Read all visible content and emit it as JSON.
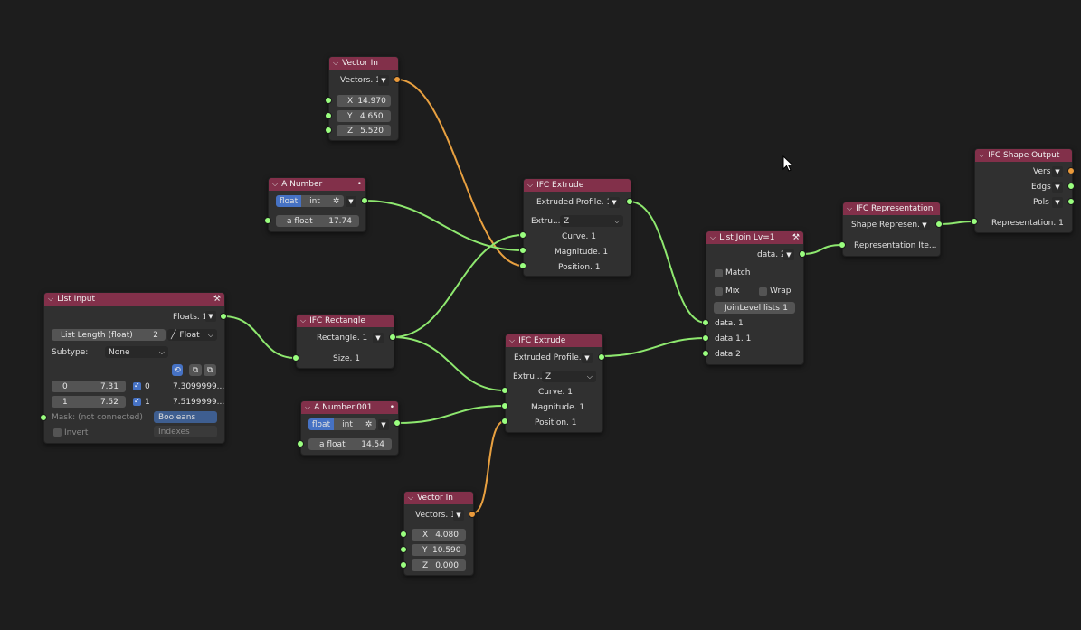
{
  "nodes": {
    "vector_in_1": {
      "title": "Vector In",
      "out_label": "Vectors. 1",
      "fields": [
        {
          "axis": "X",
          "value": "14.970"
        },
        {
          "axis": "Y",
          "value": "4.650"
        },
        {
          "axis": "Z",
          "value": "5.520"
        }
      ]
    },
    "a_number": {
      "title": "A Number",
      "seg": [
        "float",
        "int"
      ],
      "field_label": "a float",
      "field_value": "17.74"
    },
    "ifc_extrude_1": {
      "title": "IFC Extrude",
      "out_label": "Extruded Profile. 1",
      "extru_label": "Extru...",
      "extru_value": "Z",
      "inputs": [
        "Curve. 1",
        "Magnitude. 1",
        "Position. 1"
      ]
    },
    "list_input": {
      "title": "List Input",
      "out_label": "Floats. 1",
      "length_label": "List Length (float)",
      "length_value": "2",
      "type_value": "Float",
      "subtype_label": "Subtype:",
      "subtype_value": "None",
      "items": [
        {
          "index": "0",
          "value": "7.31",
          "check": "0",
          "full": "7.3099999..."
        },
        {
          "index": "1",
          "value": "7.52",
          "check": "1",
          "full": "7.5199999..."
        }
      ],
      "mask_label": "Mask: (not connected)",
      "invert_label": "Invert",
      "booleans_label": "Booleans",
      "indexes_label": "Indexes"
    },
    "ifc_rectangle": {
      "title": "IFC Rectangle",
      "out_label": "Rectangle. 1",
      "input": "Size. 1"
    },
    "a_number_001": {
      "title": "A Number.001",
      "seg": [
        "float",
        "int"
      ],
      "field_label": "a float",
      "field_value": "14.54"
    },
    "ifc_extrude_2": {
      "title": "IFC Extrude",
      "out_label": "Extruded Profile. 1",
      "extru_label": "Extru...",
      "extru_value": "Z",
      "inputs": [
        "Curve. 1",
        "Magnitude. 1",
        "Position. 1"
      ]
    },
    "vector_in_2": {
      "title": "Vector In",
      "out_label": "Vectors. 1",
      "fields": [
        {
          "axis": "X",
          "value": "4.080"
        },
        {
          "axis": "Y",
          "value": "10.590"
        },
        {
          "axis": "Z",
          "value": "0.000"
        }
      ]
    },
    "list_join": {
      "title": "List Join Lv=1",
      "out_label": "data. 2",
      "match_label": "Match",
      "mix_label": "Mix",
      "wrap_label": "Wrap",
      "join_label": "JoinLevel lists",
      "join_value": "1",
      "inputs": [
        "data. 1",
        "data 1. 1",
        "data 2"
      ]
    },
    "ifc_representation": {
      "title": "IFC Representation",
      "out_label": "Shape Represen...",
      "input": "Representation Ite..."
    },
    "ifc_shape_output": {
      "title": "IFC Shape Output",
      "outputs": [
        "Vers",
        "Edgs",
        "Pols"
      ],
      "input": "Representation. 1"
    }
  },
  "colors": {
    "header": "#82304a",
    "socket_green": "#9aff7f",
    "socket_orange": "#ea9a3b",
    "wire_green": "#8ee86f",
    "wire_orange": "#e8a040",
    "background": "#1d1d1d"
  }
}
